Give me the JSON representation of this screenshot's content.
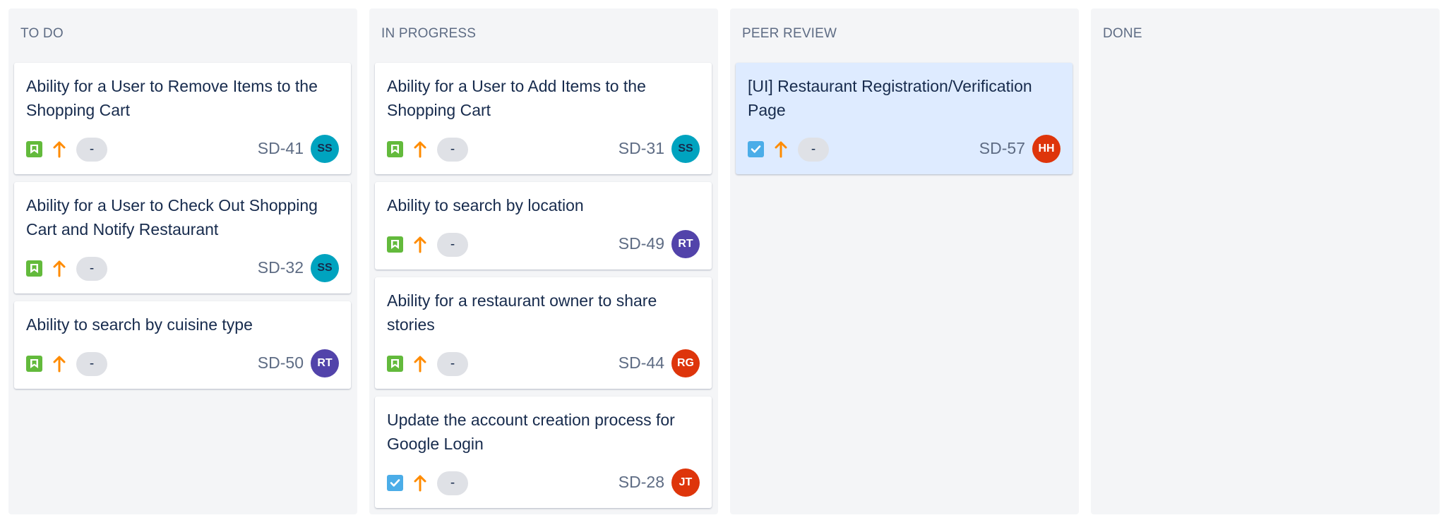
{
  "columns": [
    {
      "title": "TO DO",
      "cards": [
        {
          "title": "Ability for a User to Remove Items to the Shopping Cart",
          "key": "SD-41",
          "estimate": "-",
          "assignee": "SS",
          "type": "story"
        },
        {
          "title": "Ability for a User to Check Out Shopping Cart and Notify Restaurant",
          "key": "SD-32",
          "estimate": "-",
          "assignee": "SS",
          "type": "story"
        },
        {
          "title": "Ability to search by cuisine type",
          "key": "SD-50",
          "estimate": "-",
          "assignee": "RT",
          "type": "story"
        }
      ]
    },
    {
      "title": "IN PROGRESS",
      "cards": [
        {
          "title": "Ability for a User to Add Items to the Shopping Cart",
          "key": "SD-31",
          "estimate": "-",
          "assignee": "SS",
          "type": "story"
        },
        {
          "title": "Ability to search by location",
          "key": "SD-49",
          "estimate": "-",
          "assignee": "RT",
          "type": "story"
        },
        {
          "title": "Ability for a restaurant owner to share stories",
          "key": "SD-44",
          "estimate": "-",
          "assignee": "RG",
          "type": "story"
        },
        {
          "title": "Update the account creation process for Google Login",
          "key": "SD-28",
          "estimate": "-",
          "assignee": "JT",
          "type": "task"
        }
      ]
    },
    {
      "title": "PEER REVIEW",
      "cards": [
        {
          "title": "[UI] Restaurant Registration/Verification Page",
          "key": "SD-57",
          "estimate": "-",
          "assignee": "HH",
          "type": "task"
        }
      ]
    },
    {
      "title": "DONE",
      "cards": []
    }
  ],
  "icons": {
    "story": "bookmark-icon",
    "task": "checkbox-icon",
    "priority": "arrow-up-icon"
  },
  "colors": {
    "story": "#63ba3c",
    "task": "#4bade8",
    "priority": "#ff8b00",
    "selected_card": "#deebff"
  }
}
